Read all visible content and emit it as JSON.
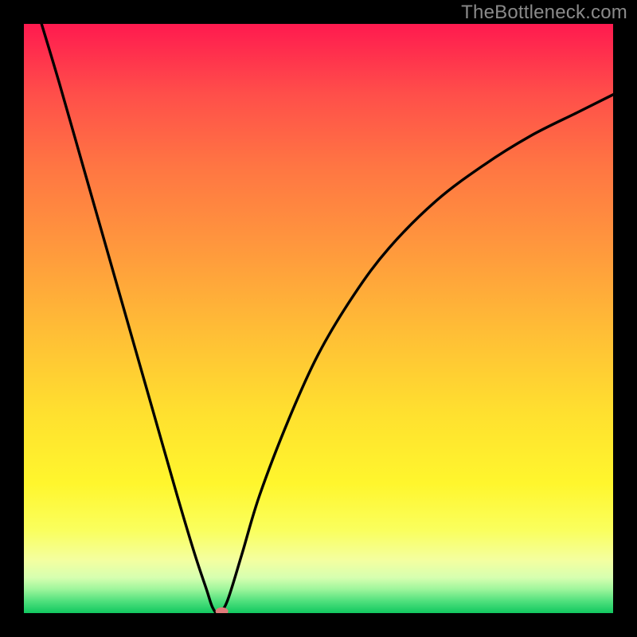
{
  "attribution": "TheBottleneck.com",
  "chart_data": {
    "type": "line",
    "title": "",
    "xlabel": "",
    "ylabel": "",
    "xlim": [
      0,
      100
    ],
    "ylim": [
      0,
      100
    ],
    "series": [
      {
        "name": "bottleneck-curve",
        "x_minimum": 33,
        "points": [
          {
            "x": 3.0,
            "y": 100.0
          },
          {
            "x": 6.0,
            "y": 90.0
          },
          {
            "x": 10.0,
            "y": 76.0
          },
          {
            "x": 14.0,
            "y": 62.0
          },
          {
            "x": 18.0,
            "y": 48.0
          },
          {
            "x": 22.0,
            "y": 34.0
          },
          {
            "x": 26.0,
            "y": 20.0
          },
          {
            "x": 29.0,
            "y": 10.0
          },
          {
            "x": 31.0,
            "y": 4.0
          },
          {
            "x": 32.0,
            "y": 1.0
          },
          {
            "x": 33.0,
            "y": 0.0
          },
          {
            "x": 34.5,
            "y": 2.0
          },
          {
            "x": 37.0,
            "y": 10.0
          },
          {
            "x": 40.0,
            "y": 20.0
          },
          {
            "x": 45.0,
            "y": 33.0
          },
          {
            "x": 50.0,
            "y": 44.0
          },
          {
            "x": 56.0,
            "y": 54.0
          },
          {
            "x": 62.0,
            "y": 62.0
          },
          {
            "x": 70.0,
            "y": 70.0
          },
          {
            "x": 78.0,
            "y": 76.0
          },
          {
            "x": 86.0,
            "y": 81.0
          },
          {
            "x": 94.0,
            "y": 85.0
          },
          {
            "x": 100.0,
            "y": 88.0
          }
        ]
      }
    ],
    "marker": {
      "x": 33.6,
      "y": 0.3
    }
  },
  "colors": {
    "gradient_top": "#ff1a4f",
    "gradient_mid": "#ffe02f",
    "gradient_bottom": "#12c860",
    "curve": "#000000",
    "marker": "#e07a7a",
    "background": "#000000",
    "attribution_text": "#8a8a8a"
  }
}
